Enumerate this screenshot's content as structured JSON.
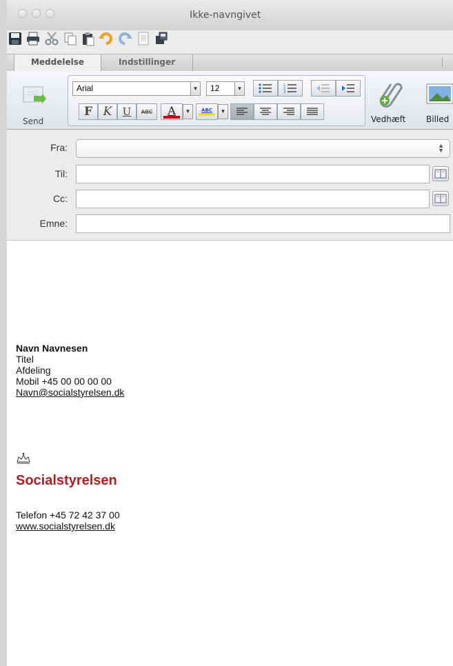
{
  "window": {
    "title": "Ikke-navngivet"
  },
  "tabs": [
    {
      "label": "Meddelelse",
      "active": true
    },
    {
      "label": "Indstillinger",
      "active": false
    }
  ],
  "ribbon": {
    "send_label": "Send",
    "font_family": "Arial",
    "font_size": "12",
    "bold_label": "F",
    "italic_label": "K",
    "underline_label": "U",
    "strike_label": "ABC",
    "font_color_label": "A",
    "highlight_label": "ABC",
    "attach_label": "Vedhæft",
    "picture_label": "Billed",
    "font_color": "#d0021b",
    "highlight_color": "#f5e300"
  },
  "headers": {
    "from_label": "Fra:",
    "to_label": "Til:",
    "cc_label": "Cc:",
    "subject_label": "Emne:"
  },
  "signature": {
    "name": "Navn Navnesen",
    "title": "Titel",
    "department": "Afdeling",
    "mobile": "Mobil +45 00 00 00 00",
    "email": "Navn@socialstyrelsen.dk",
    "org_name": "Socialstyrelsen",
    "phone": "Telefon +45 72 42 37 00",
    "website": "www.socialstyrelsen.dk",
    "brand_color": "#b01d22"
  }
}
